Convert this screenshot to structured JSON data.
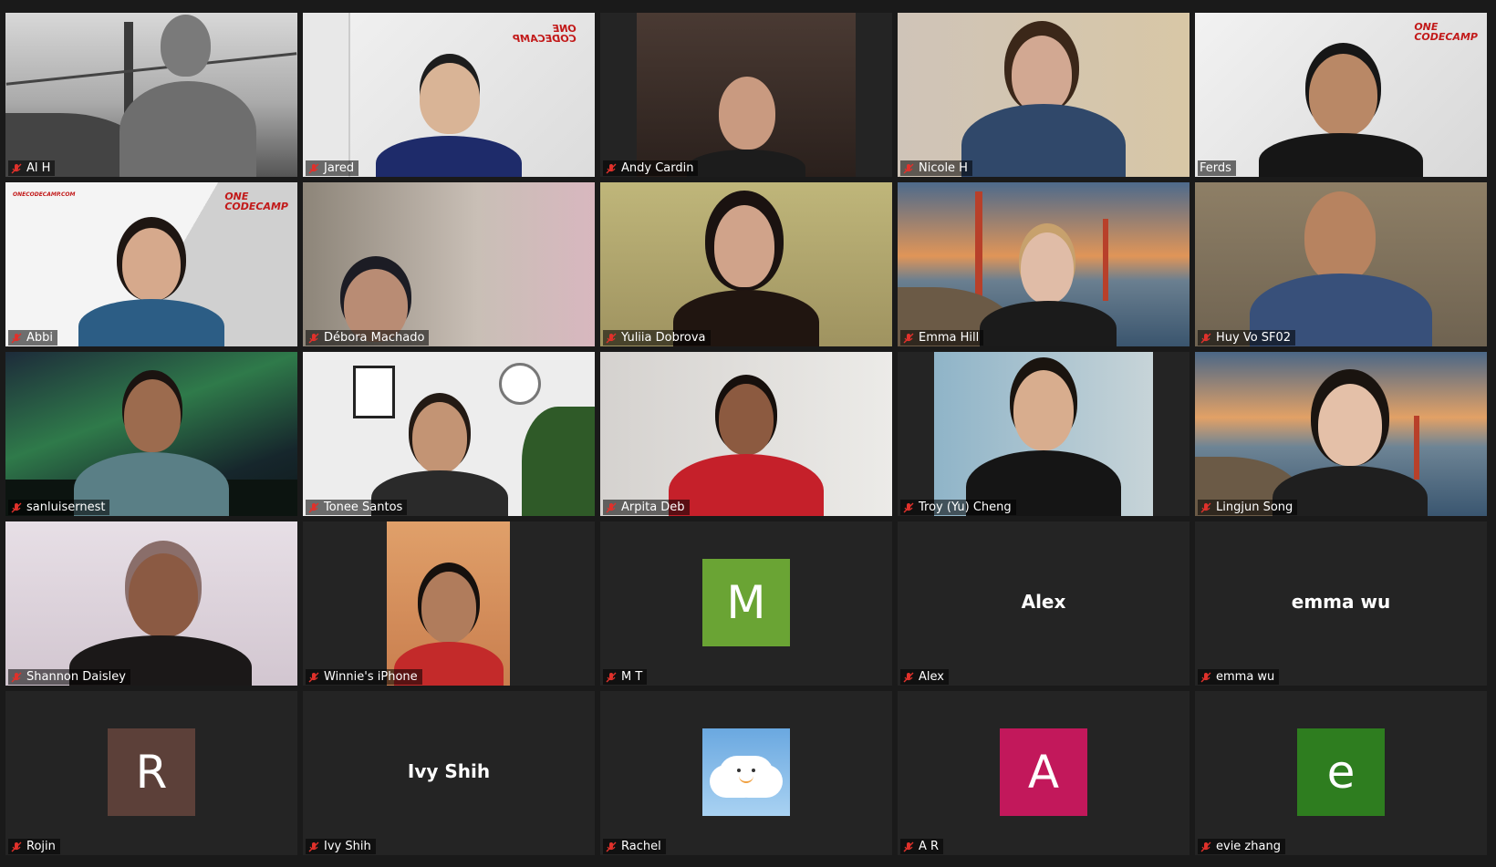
{
  "participants": [
    {
      "name": "Al H",
      "type": "video"
    },
    {
      "name": "Jared",
      "type": "video"
    },
    {
      "name": "Andy Cardin",
      "type": "video"
    },
    {
      "name": "Nicole H",
      "type": "video"
    },
    {
      "name": "Ferds",
      "type": "video",
      "speaking": true
    },
    {
      "name": "Abbi",
      "type": "video"
    },
    {
      "name": "Débora Machado",
      "type": "video"
    },
    {
      "name": "Yuliia Dobrova",
      "type": "video"
    },
    {
      "name": "Emma Hill",
      "type": "video"
    },
    {
      "name": "Huy Vo SF02",
      "type": "video"
    },
    {
      "name": "sanluisernest",
      "type": "video"
    },
    {
      "name": "Tonee Santos",
      "type": "video"
    },
    {
      "name": "Arpita Deb",
      "type": "video"
    },
    {
      "name": "Troy (Yu) Cheng",
      "type": "video"
    },
    {
      "name": "Lingjun Song",
      "type": "video"
    },
    {
      "name": "Shannon Daisley",
      "type": "video"
    },
    {
      "name": "Winnie's iPhone",
      "type": "video"
    },
    {
      "name": "M T",
      "type": "avatar",
      "letter": "M",
      "color": "#6aa434"
    },
    {
      "name": "Alex",
      "type": "name",
      "display": "Alex"
    },
    {
      "name": "emma wu",
      "type": "name",
      "display": "emma wu"
    },
    {
      "name": "Rojin",
      "type": "avatar",
      "letter": "R",
      "color": "#5c4039"
    },
    {
      "name": "Ivy Shih",
      "type": "name",
      "display": "Ivy Shih"
    },
    {
      "name": "Rachel",
      "type": "picture"
    },
    {
      "name": "A R",
      "type": "avatar",
      "letter": "A",
      "color": "#c2185b"
    },
    {
      "name": "evie zhang",
      "type": "avatar",
      "letter": "e",
      "color": "#2e7d1f"
    }
  ],
  "logos": {
    "brand_top": "ONE",
    "brand_bottom": "CODECAMP",
    "site": "ONECODECAMP.COM"
  },
  "colors": {
    "muted_icon": "#e0312b",
    "speaker_border": "#d6ef2a",
    "tile_bg": "#242424"
  }
}
